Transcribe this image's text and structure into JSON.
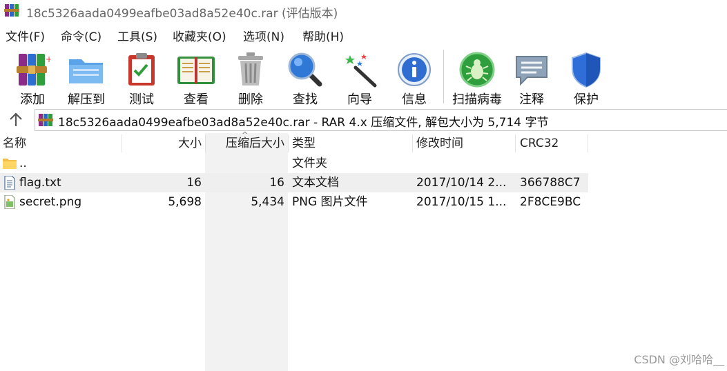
{
  "window": {
    "title": "18c5326aada0499eafbe03ad8a52e40c.rar (评估版本)"
  },
  "menu": [
    "文件(F)",
    "命令(C)",
    "工具(S)",
    "收藏夹(O)",
    "选项(N)",
    "帮助(H)"
  ],
  "toolbar": [
    {
      "label": "添加",
      "icon": "books-icon"
    },
    {
      "label": "解压到",
      "icon": "folder-extract-icon"
    },
    {
      "label": "测试",
      "icon": "clipboard-check-icon"
    },
    {
      "label": "查看",
      "icon": "book-open-icon"
    },
    {
      "label": "删除",
      "icon": "trash-icon"
    },
    {
      "label": "查找",
      "icon": "magnifier-icon"
    },
    {
      "label": "向导",
      "icon": "magic-wand-icon"
    },
    {
      "label": "信息",
      "icon": "info-icon"
    },
    {
      "label": "扫描病毒",
      "icon": "bug-icon"
    },
    {
      "label": "注释",
      "icon": "comment-icon"
    },
    {
      "label": "保护",
      "icon": "shield-icon"
    }
  ],
  "address": {
    "path": "18c5326aada0499eafbe03ad8a52e40c.rar - RAR 4.x 压缩文件, 解包大小为 5,714 字节"
  },
  "columns": [
    "名称",
    "大小",
    "压缩后大小",
    "类型",
    "修改时间",
    "CRC32"
  ],
  "files": [
    {
      "name": "..",
      "size": "",
      "packed": "",
      "type": "文件夹",
      "modified": "",
      "crc": "",
      "icon": "folder-icon"
    },
    {
      "name": "flag.txt",
      "size": "16",
      "packed": "16",
      "type": "文本文档",
      "modified": "2017/10/14 2...",
      "crc": "366788C7",
      "icon": "text-file-icon"
    },
    {
      "name": "secret.png",
      "size": "5,698",
      "packed": "5,434",
      "type": "PNG 图片文件",
      "modified": "2017/10/15 1...",
      "crc": "2F8CE9BC",
      "icon": "image-file-icon"
    }
  ],
  "watermark": "CSDN @刘哈哈__"
}
